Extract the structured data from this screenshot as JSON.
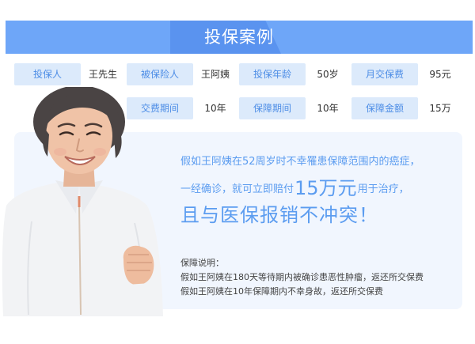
{
  "banner": {
    "title": "投保案例"
  },
  "info": {
    "row1": [
      {
        "label": "投保人",
        "value": "王先生"
      },
      {
        "label": "被保险人",
        "value": "王阿姨"
      },
      {
        "label": "投保年龄",
        "value": "50岁"
      },
      {
        "label": "月交保费",
        "value": "95元"
      }
    ],
    "row2": [
      {
        "label": "交费期间",
        "value": "10年"
      },
      {
        "label": "保障期间",
        "value": "10年"
      },
      {
        "label": "保障金额",
        "value": "15万"
      }
    ]
  },
  "headline": {
    "line1": "假如王阿姨在52周岁时不幸罹患保障范围内的癌症，",
    "line2_prefix": "一经确诊，就可立即赔付",
    "line2_amount": "15万元",
    "line2_suffix": "用于治疗，",
    "line3": "且与医保报销不冲突！"
  },
  "notes": {
    "title": "保障说明：",
    "items": [
      "假如王阿姨在180天等待期内被确诊患恶性肿瘤，返还所交保费",
      "假如王阿姨在10年保障期内不幸身故，返还所交保费"
    ]
  },
  "colors": {
    "banner": "#6ea6f8",
    "label_bg": "#dceafb",
    "label_text": "#4d8de6",
    "headline": "#5b9cf0",
    "card_bg": "#f1f6fe"
  },
  "icons": {
    "portrait": "smiling-woman-portrait"
  }
}
